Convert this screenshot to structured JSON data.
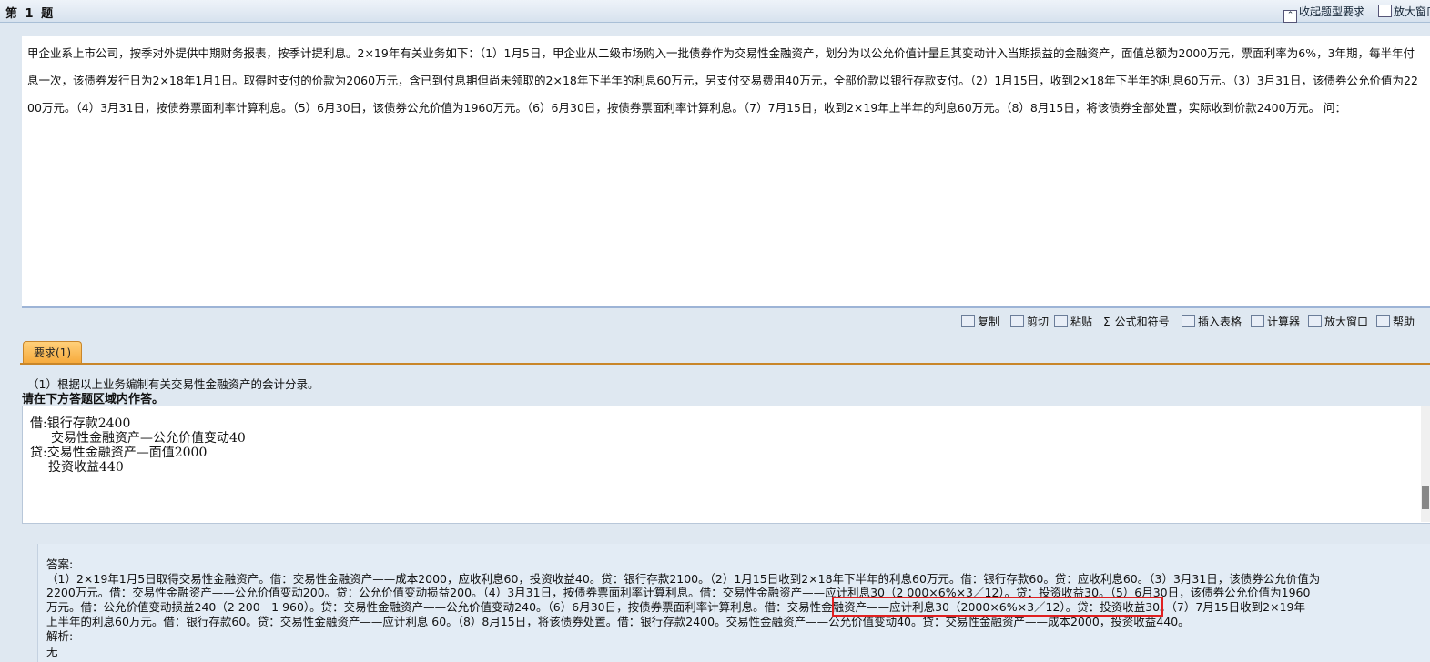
{
  "header": {
    "question_title": "第 1 题",
    "collapse_label": "收起题型要求",
    "enlarge_label": "放大窗口"
  },
  "question": {
    "text": "甲企业系上市公司，按季对外提供中期财务报表，按季计提利息。2×19年有关业务如下：（1）1月5日，甲企业从二级市场购入一批债券作为交易性金融资产，划分为以公允价值计量且其变动计入当期损益的金融资产，面值总额为2000万元，票面利率为6%，3年期，每半年付息一次，该债券发行日为2×18年1月1日。取得时支付的价款为2060万元，含已到付息期但尚未领取的2×18年下半年的利息60万元，另支付交易费用40万元，全部价款以银行存款支付。（2）1月15日，收到2×18年下半年的利息60万元。（3）3月31日，该债券公允价值为2200万元。（4）3月31日，按债券票面利率计算利息。（5）6月30日，该债券公允价值为1960万元。（6）6月30日，按债券票面利率计算利息。（7）7月15日，收到2×19年上半年的利息60万元。（8）8月15日，将该债券全部处置，实际收到价款2400万元。 问："
  },
  "toolbar": {
    "copy": "复制",
    "cut": "剪切",
    "paste": "粘贴",
    "formula": "公式和符号",
    "insert_table": "插入表格",
    "calculator": "计算器",
    "enlarge": "放大窗口",
    "help": "帮助"
  },
  "tab": {
    "label": "要求(1)"
  },
  "requirement": {
    "text": "（1）根据以上业务编制有关交易性金融资产的会计分录。",
    "hint": "请在下方答题区域内作答。"
  },
  "answer_input": {
    "lines": [
      "借:银行存款2400",
      "交易性金融资产—公允价值变动40",
      "贷:交易性金融资产—面值2000",
      "投资收益440"
    ]
  },
  "solution": {
    "answer_label": "答案:",
    "lines": [
      "（1）2×19年1月5日取得交易性金融资产。借：交易性金融资产——成本2000，应收利息60，投资收益40。贷：银行存款2100。（2）1月15日收到2×18年下半年的利息60万元。借：银行存款60。贷：应收利息60。（3）3月31日，该债券公允价值为",
      "2200万元。借：交易性金融资产——公允价值变动200。贷：公允价值变动损益200。（4）3月31日，按债券票面利率计算利息。借：交易性金融资产——应计利息30（2 000×6%×3／12）。贷：投资收益30。（5）6月30日，该债券公允价值为1960",
      "万元。借：公允价值变动损益240（2 200－1 960）。贷：交易性金融资产——公允价值变动240。（6）6月30日，按债券票面利率计算利息。借：交易性金融资产——应计利息30（2000×6%×3／12）。贷：投资收益30。（7）7月15日收到2×19年",
      "上半年的利息60万元。借：银行存款60。贷：交易性金融资产——应计利息 60。（8）8月15日，将该债券处置。借：银行存款2400。交易性金融资产——公允价值变动40。贷：交易性金融资产——成本2000，投资收益440。"
    ],
    "analysis_label": "解析:",
    "analysis_text": "无"
  },
  "colors": {
    "background": "#dfe8f1",
    "tab": "#f6a93a",
    "highlight": "#e02020"
  }
}
